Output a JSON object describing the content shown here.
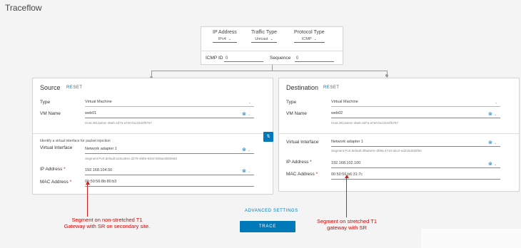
{
  "page": {
    "title": "Traceflow"
  },
  "config": {
    "ip_address": {
      "label": "IP Address",
      "value": "IPv4"
    },
    "traffic_type": {
      "label": "Traffic Type",
      "value": "Unicast"
    },
    "protocol_type": {
      "label": "Protocol Type",
      "value": "ICMP"
    },
    "icmp_id": {
      "label": "ICMP ID",
      "value": "0"
    },
    "sequence": {
      "label": "Sequence",
      "value": "0"
    }
  },
  "source": {
    "title": "Source",
    "reset": "RESET",
    "type": {
      "label": "Type",
      "value": "Virtual Machine"
    },
    "vm_name": {
      "label": "VM Name",
      "value": "web01",
      "host": "Host:2813a04c-46eb-4d7a-a7e0-fa13344f0757"
    },
    "vif_hint": "Identify a virtual interface for packet injection",
    "virtual_interface": {
      "label": "Virtual Interface",
      "value": "Network adapter 1",
      "segment_port": "Segment Port:default:a16ca94c-d279-46b5-93e2-828ac808369d"
    },
    "ip_address": {
      "label": "IP Address",
      "required": "*",
      "value": "192.168.104.50"
    },
    "mac_address": {
      "label": "MAC Address",
      "required": "*",
      "value": "00:50:56:8b:80:b3"
    }
  },
  "destination": {
    "title": "Destination",
    "reset": "RESET",
    "type": {
      "label": "Type",
      "value": "Virtual Machine"
    },
    "vm_name": {
      "label": "VM Name",
      "value": "web02",
      "host": "Host:2813a04c-46eb-4d7a-a7e0-fa13344f0757"
    },
    "virtual_interface": {
      "label": "Virtual Interface",
      "value": "Network adapter 1",
      "segment_port": "Segment Port:default:3f6a5e0c-d09a-4710-abc2-ed21bd25bf60"
    },
    "ip_address": {
      "label": "IP Address",
      "required": "*",
      "value": "192.168.102.100"
    },
    "mac_address": {
      "label": "MAC Address",
      "required": "*",
      "value": "00:50:56:b6:31:7c"
    }
  },
  "swap_label": "⇅",
  "advanced_settings": "ADVANCED SETTINGS",
  "trace_button": "TRACE",
  "annotations": {
    "left_line1": "Segment on non-stretched T1",
    "left_line2": "Gateway with SR on secondary site.",
    "right_line1": "Segment on stretched T1",
    "right_line2": "gateway with SR"
  },
  "icons": {
    "clear": "⊗",
    "chevron": "⌄"
  },
  "colors": {
    "accent": "#0079b8",
    "annotation": "#d21d1d"
  }
}
